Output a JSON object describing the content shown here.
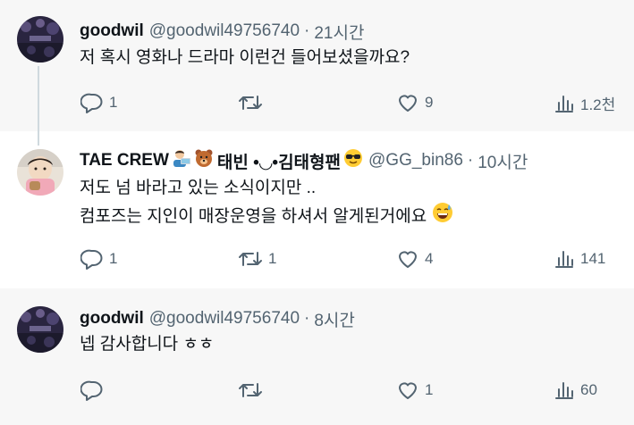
{
  "tweets": [
    {
      "name": "goodwil",
      "handle": "@goodwil49756740",
      "separator": "·",
      "time": "21시간",
      "lines": [
        "저 혹시 영화나 드라마 이런건 들어보셨을까요?"
      ],
      "actions": {
        "reply": "1",
        "retweet": "",
        "like": "9",
        "views": "1.2천"
      }
    },
    {
      "name": "TAE CREW",
      "name_suffix": "태빈 •◡•김태형팬",
      "handle": "@GG_bin86",
      "separator": "·",
      "time": "10시간",
      "lines": [
        "저도 넘 바라고 있는 소식이지만 ..",
        "컴포즈는 지인이 매장운영을 하셔서 알게된거에요"
      ],
      "actions": {
        "reply": "1",
        "retweet": "1",
        "like": "4",
        "views": "141"
      }
    },
    {
      "name": "goodwil",
      "handle": "@goodwil49756740",
      "separator": "·",
      "time": "8시간",
      "lines": [
        "넵 감사합니다 ㅎㅎ"
      ],
      "actions": {
        "reply": "",
        "retweet": "",
        "like": "1",
        "views": "60"
      }
    }
  ],
  "colors": {
    "secondary_text": "#536471",
    "primary_text": "#0f1419",
    "thread_line": "#cfd9de"
  },
  "icons": [
    "reply-icon",
    "retweet-icon",
    "like-icon",
    "views-icon"
  ]
}
